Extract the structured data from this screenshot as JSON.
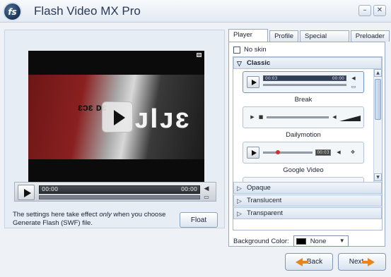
{
  "window": {
    "logo_text": "fs",
    "title": "Flash Video MX Pro",
    "minimize_glyph": "–",
    "close_glyph": "✕"
  },
  "preview": {
    "overlay_text": "ᴊIᴊɛ",
    "sub_text": "ɛɔɛ ᴅɛ",
    "player": {
      "time_elapsed": "00:00",
      "time_total": "00:00",
      "volume_glyph": "◀",
      "fullscreen_glyph": "▭"
    }
  },
  "note": {
    "prefix": "The settings here take effect ",
    "emphasis": "only",
    "suffix": " when you choose Generate Flash (SWF) file."
  },
  "float_button": "Float",
  "tabs": [
    {
      "label": "Player skin",
      "active": true
    },
    {
      "label": "Profile"
    },
    {
      "label": "Special effects"
    },
    {
      "label": "Preloader"
    }
  ],
  "no_skin": {
    "label": "No skin",
    "checked": false
  },
  "groups": {
    "classic": {
      "label": "Classic",
      "arrow": "▽"
    },
    "opaque": {
      "label": "Opaque",
      "arrow": "▷"
    },
    "translucent": {
      "label": "Translucent",
      "arrow": "▷"
    },
    "transparent": {
      "label": "Transparent",
      "arrow": "▷"
    }
  },
  "skins": [
    {
      "caption": "Break",
      "selected": true,
      "time_left": "00:03",
      "time_right": "00:00"
    },
    {
      "caption": "Dailymotion"
    },
    {
      "caption": "Google Video",
      "time_box": "00:03"
    }
  ],
  "scrollbar": {
    "up": "▲",
    "down": "▼"
  },
  "background_color": {
    "label": "Background Color:",
    "value": "None",
    "arrow": "▼",
    "swatch": "#000000"
  },
  "nav": {
    "back": "Back",
    "next": "Next"
  },
  "colors": {
    "accent_arrow": "#e8851c",
    "selection": "#6f95c8"
  }
}
